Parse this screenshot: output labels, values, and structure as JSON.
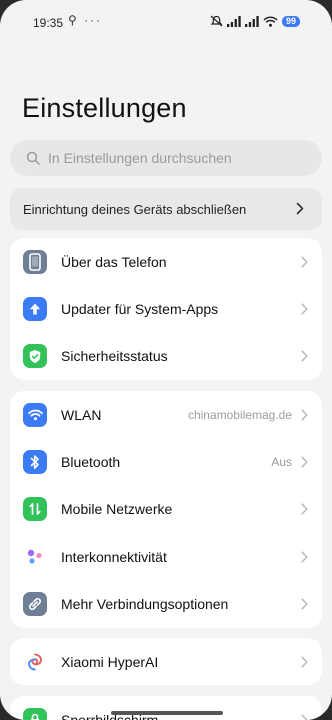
{
  "status_bar": {
    "time": "19:35",
    "left_icons": "⚲ ···",
    "battery": "99"
  },
  "header": {
    "title": "Einstellungen"
  },
  "search": {
    "placeholder": "In Einstellungen durchsuchen"
  },
  "setup_banner": {
    "label": "Einrichtung deines Geräts abschließen"
  },
  "groups": [
    {
      "items": [
        {
          "label": "Über das Telefon",
          "icon": "phone-icon",
          "color": "#6e7f96"
        },
        {
          "label": "Updater für System-Apps",
          "icon": "arrow-up-icon",
          "color": "#3b7cf4"
        },
        {
          "label": "Sicherheitsstatus",
          "icon": "shield-check-icon",
          "color": "#31c25a"
        }
      ]
    },
    {
      "items": [
        {
          "label": "WLAN",
          "value": "chinamobilemag.de",
          "icon": "wifi-icon",
          "color": "#3b7cf4"
        },
        {
          "label": "Bluetooth",
          "value": "Aus",
          "icon": "bluetooth-icon",
          "color": "#3b7cf4"
        },
        {
          "label": "Mobile Netzwerke",
          "icon": "mobile-network-icon",
          "color": "#31c25a"
        },
        {
          "label": "Interkonnektivität",
          "icon": "interconnect-icon",
          "color": "#9b6cf2"
        },
        {
          "label": "Mehr Verbindungsoptionen",
          "icon": "link-icon",
          "color": "#6e7f96"
        }
      ]
    },
    {
      "items": [
        {
          "label": "Xiaomi HyperAI",
          "icon": "hyperai-icon",
          "color": "#e55c5c"
        }
      ]
    },
    {
      "items": [
        {
          "label": "Sperrbildschirm",
          "icon": "lock-icon",
          "color": "#31c25a"
        }
      ]
    }
  ]
}
